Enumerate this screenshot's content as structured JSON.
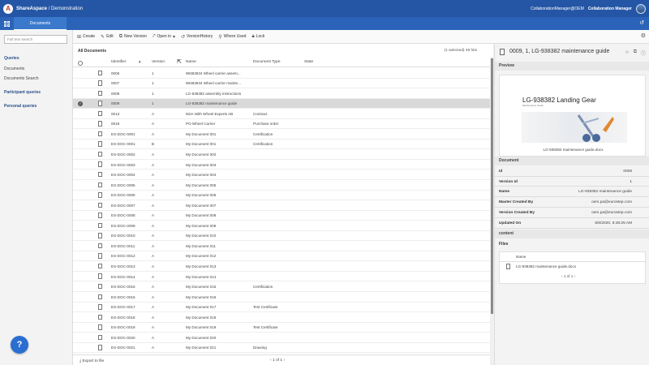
{
  "header": {
    "logo_letter": "A",
    "app_name": "ShareAspace",
    "separator": " / ",
    "workspace": "Demonstration",
    "user": "CollaborationManager@OEM",
    "role": "Collaboration Manager"
  },
  "nav": {
    "tab": "Documents"
  },
  "sidebar": {
    "search_placeholder": "Full text search",
    "queries_heading": "Queries",
    "items": [
      "Documents",
      "Documents Search"
    ],
    "participant_heading": "Participant queries",
    "personal_heading": "Personal queries",
    "help_label": "?"
  },
  "toolbar": {
    "create": "Create",
    "edit": "Edit",
    "new_version": "New Version",
    "open_in": "Open in",
    "version_history": "VersionHistory",
    "where_used": "Where Used",
    "lock": "Lock"
  },
  "list": {
    "title": "All Documents",
    "count": "(1 selected) 49 hits",
    "columns": [
      "Identifier",
      "Version",
      "Name",
      "Document Type",
      "State"
    ],
    "rows": [
      {
        "id": "0006",
        "ver": "1",
        "name": "99383834 Wheel carrier assem...",
        "type": ""
      },
      {
        "id": "0007",
        "ver": "1",
        "name": "99383834 Wheel carrier mainte...",
        "type": ""
      },
      {
        "id": "0008",
        "ver": "1",
        "name": "LG-938382 assembly instructions",
        "type": ""
      },
      {
        "id": "0009",
        "ver": "1",
        "name": "LG-938382 maintenance guide",
        "type": ""
      },
      {
        "id": "0013",
        "ver": "A",
        "name": "NDA With Wheel Experts AB",
        "type": "Contract"
      },
      {
        "id": "0018",
        "ver": "A",
        "name": "PO Wheel Carrier",
        "type": "Purchase order"
      },
      {
        "id": "ES-DOC-0001",
        "ver": "A",
        "name": "My Document 001",
        "type": "Certification"
      },
      {
        "id": "ES-DOC-0001",
        "ver": "B",
        "name": "My Document 001",
        "type": "Certification"
      },
      {
        "id": "ES-DOC-0002",
        "ver": "A",
        "name": "My Document 002",
        "type": ""
      },
      {
        "id": "ES-DOC-0003",
        "ver": "A",
        "name": "My Document 003",
        "type": ""
      },
      {
        "id": "ES-DOC-0004",
        "ver": "A",
        "name": "My Document 004",
        "type": ""
      },
      {
        "id": "ES-DOC-0005",
        "ver": "A",
        "name": "My Document 005",
        "type": ""
      },
      {
        "id": "ES-DOC-0006",
        "ver": "A",
        "name": "My Document 006",
        "type": ""
      },
      {
        "id": "ES-DOC-0007",
        "ver": "A",
        "name": "My Document 007",
        "type": ""
      },
      {
        "id": "ES-DOC-0008",
        "ver": "A",
        "name": "My Document 008",
        "type": ""
      },
      {
        "id": "ES-DOC-0009",
        "ver": "A",
        "name": "My Document 009",
        "type": ""
      },
      {
        "id": "ES-DOC-0010",
        "ver": "A",
        "name": "My Document 010",
        "type": ""
      },
      {
        "id": "ES-DOC-0011",
        "ver": "A",
        "name": "My Document 011",
        "type": ""
      },
      {
        "id": "ES-DOC-0012",
        "ver": "A",
        "name": "My Document 012",
        "type": ""
      },
      {
        "id": "ES-DOC-0013",
        "ver": "A",
        "name": "My Document 013",
        "type": ""
      },
      {
        "id": "ES-DOC-0014",
        "ver": "A",
        "name": "My Document 014",
        "type": ""
      },
      {
        "id": "ES-DOC-0015",
        "ver": "A",
        "name": "My Document 015",
        "type": "Certification"
      },
      {
        "id": "ES-DOC-0016",
        "ver": "A",
        "name": "My Document 016",
        "type": ""
      },
      {
        "id": "ES-DOC-0017",
        "ver": "A",
        "name": "My Document 017",
        "type": "Test Certificate"
      },
      {
        "id": "ES-DOC-0018",
        "ver": "A",
        "name": "My Document 018",
        "type": ""
      },
      {
        "id": "ES-DOC-0019",
        "ver": "A",
        "name": "My Document 019",
        "type": "Test Certificate"
      },
      {
        "id": "ES-DOC-0020",
        "ver": "A",
        "name": "My Document 020",
        "type": ""
      },
      {
        "id": "ES-DOC-0021",
        "ver": "A",
        "name": "My Document 021",
        "type": "Drawing"
      }
    ],
    "selected_index": 3,
    "export": "Export to file",
    "pager": "1 of 1"
  },
  "detail": {
    "title": "0009, 1, LG-938382 maintenance guide",
    "preview_heading": "Preview",
    "preview_title": "LG-938382 Landing Gear",
    "preview_subtitle": "Maintenance Guide",
    "preview_file": "LG-938382 maintenance guide.docx",
    "document_heading": "Document",
    "props": [
      {
        "k": "Id",
        "v": "0009"
      },
      {
        "k": "Version Id",
        "v": "1"
      },
      {
        "k": "Name",
        "v": "LG-938382 maintenance guide"
      },
      {
        "k": "Master Created By",
        "v": "oem.pa@eurostep.com"
      },
      {
        "k": "Version Created By",
        "v": "oem.pa@eurostep.com"
      },
      {
        "k": "Updated On",
        "v": "5/6/2020, 8:48:25 AM"
      }
    ],
    "content_heading": "content",
    "files_label": "Files",
    "files_col": "Name",
    "file_name": "LG-938382 maintenance guide.docx",
    "files_pager": "1 of 1"
  }
}
